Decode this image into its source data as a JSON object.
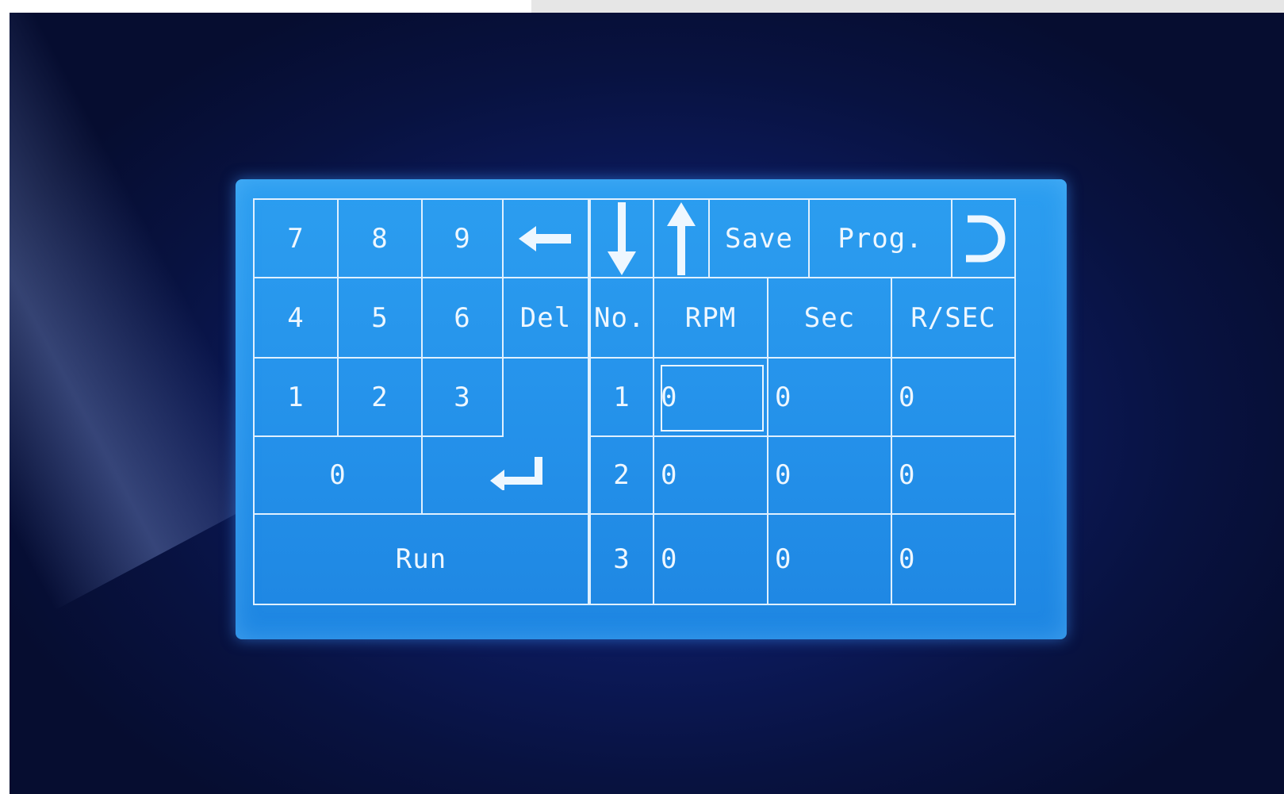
{
  "keypad": {
    "keys": [
      "7",
      "8",
      "9",
      "4",
      "5",
      "6",
      "1",
      "2",
      "3",
      "0"
    ],
    "del_label": "Del",
    "run_label": "Run"
  },
  "toolbar": {
    "save_label": "Save",
    "prog_label": "Prog."
  },
  "table": {
    "headers": [
      "No.",
      "RPM",
      "Sec",
      "R/SEC"
    ],
    "rows": [
      {
        "no": "1",
        "rpm": "0",
        "sec": "0",
        "rsec": "0"
      },
      {
        "no": "2",
        "rpm": "0",
        "sec": "0",
        "rsec": "0"
      },
      {
        "no": "3",
        "rpm": "0",
        "sec": "0",
        "rsec": "0"
      }
    ]
  },
  "icons": [
    "backspace-arrow-icon",
    "enter-icon",
    "down-arrow-icon",
    "up-arrow-icon",
    "back-return-icon"
  ],
  "colors": {
    "screen": "#2491ea",
    "lines": "#dff0ff",
    "bezel": "#0c1a5c"
  }
}
